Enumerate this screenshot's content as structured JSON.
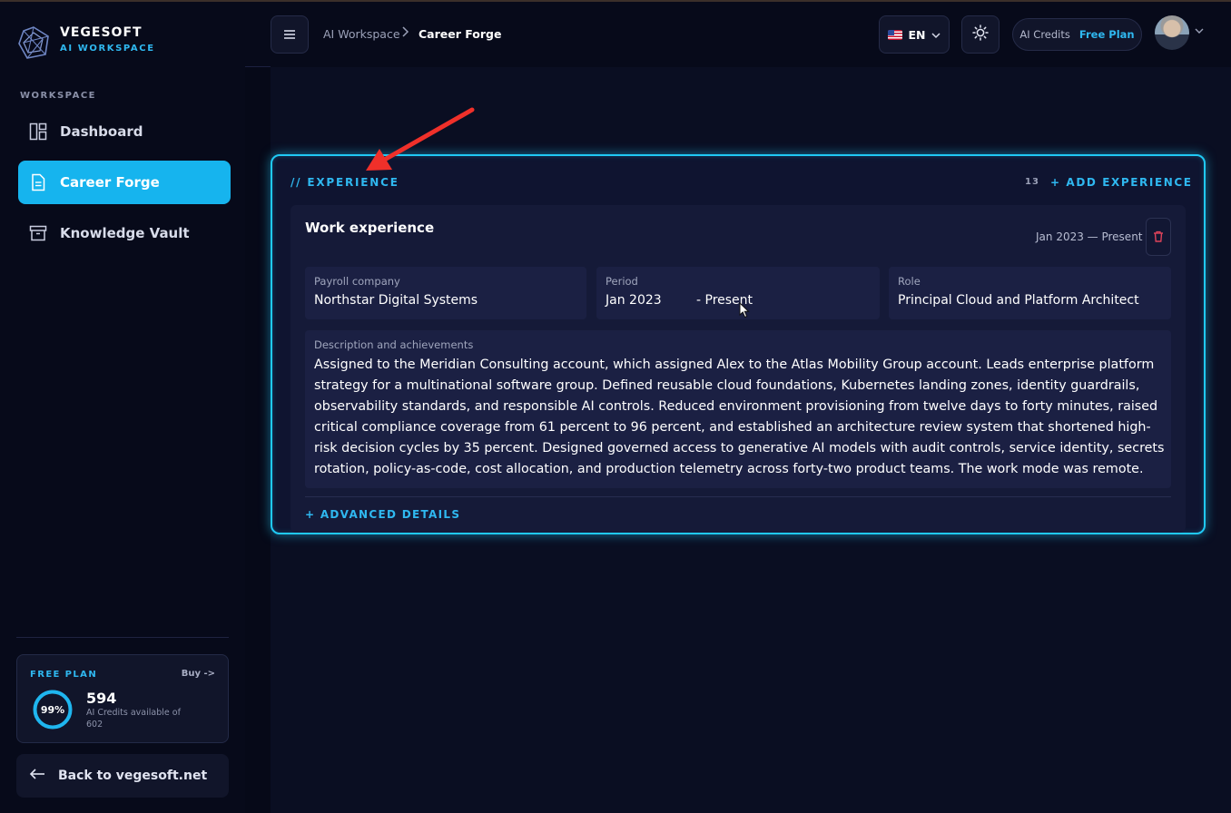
{
  "brand": {
    "name": "VEGESOFT",
    "subtitle": "AI WORKSPACE"
  },
  "sidebar": {
    "section_label": "WORKSPACE",
    "items": [
      {
        "label": "Dashboard",
        "icon": "dashboard-icon",
        "active": false
      },
      {
        "label": "Career Forge",
        "icon": "document-icon",
        "active": true
      },
      {
        "label": "Knowledge Vault",
        "icon": "archive-icon",
        "active": false
      }
    ],
    "plan": {
      "label": "FREE PLAN",
      "buy_label": "Buy ->",
      "percent_label": "99%",
      "percent_value": 0.99,
      "credits": "594",
      "credits_desc": "AI Credits available of 602"
    },
    "back_label": "Back to vegesoft.net"
  },
  "header": {
    "breadcrumb_root": "AI Workspace",
    "breadcrumb_current": "Career Forge",
    "language": "EN",
    "credits_label": "AI Credits",
    "plan_label": "Free Plan"
  },
  "experience": {
    "title": "// EXPERIENCE",
    "count": "13",
    "add_label": "+ ADD EXPERIENCE",
    "entry": {
      "title": "Work experience",
      "dates": "Jan 2023 — Present",
      "fields": {
        "company_label": "Payroll company",
        "company_value": "Northstar Digital Systems",
        "period_label": "Period",
        "period_start": "Jan 2023",
        "period_end": "- Present",
        "role_label": "Role",
        "role_value": "Principal Cloud and Platform Architect"
      },
      "description_label": "Description and achievements",
      "description": "Assigned to the Meridian Consulting account, which assigned Alex to the Atlas Mobility Group account. Leads enterprise platform strategy for a multinational software group. Defined reusable cloud foundations, Kubernetes landing zones, identity guardrails, observability standards, and responsible AI controls. Reduced environment provisioning from twelve days to forty minutes, raised critical compliance coverage from 61 percent to 96 percent, and established an architecture review system that shortened high-risk decision cycles by 35 percent. Designed governed access to generative AI models with audit controls, service identity, secrets rotation, policy-as-code, cost allocation, and production telemetry across forty-two product teams. The work mode was remote.",
      "advanced_label": "+ ADVANCED DETAILS"
    }
  },
  "colors": {
    "accent": "#2fb8f0",
    "active_nav": "#16b4ee",
    "annotation": "#f0302a",
    "delete": "#e0435a"
  }
}
